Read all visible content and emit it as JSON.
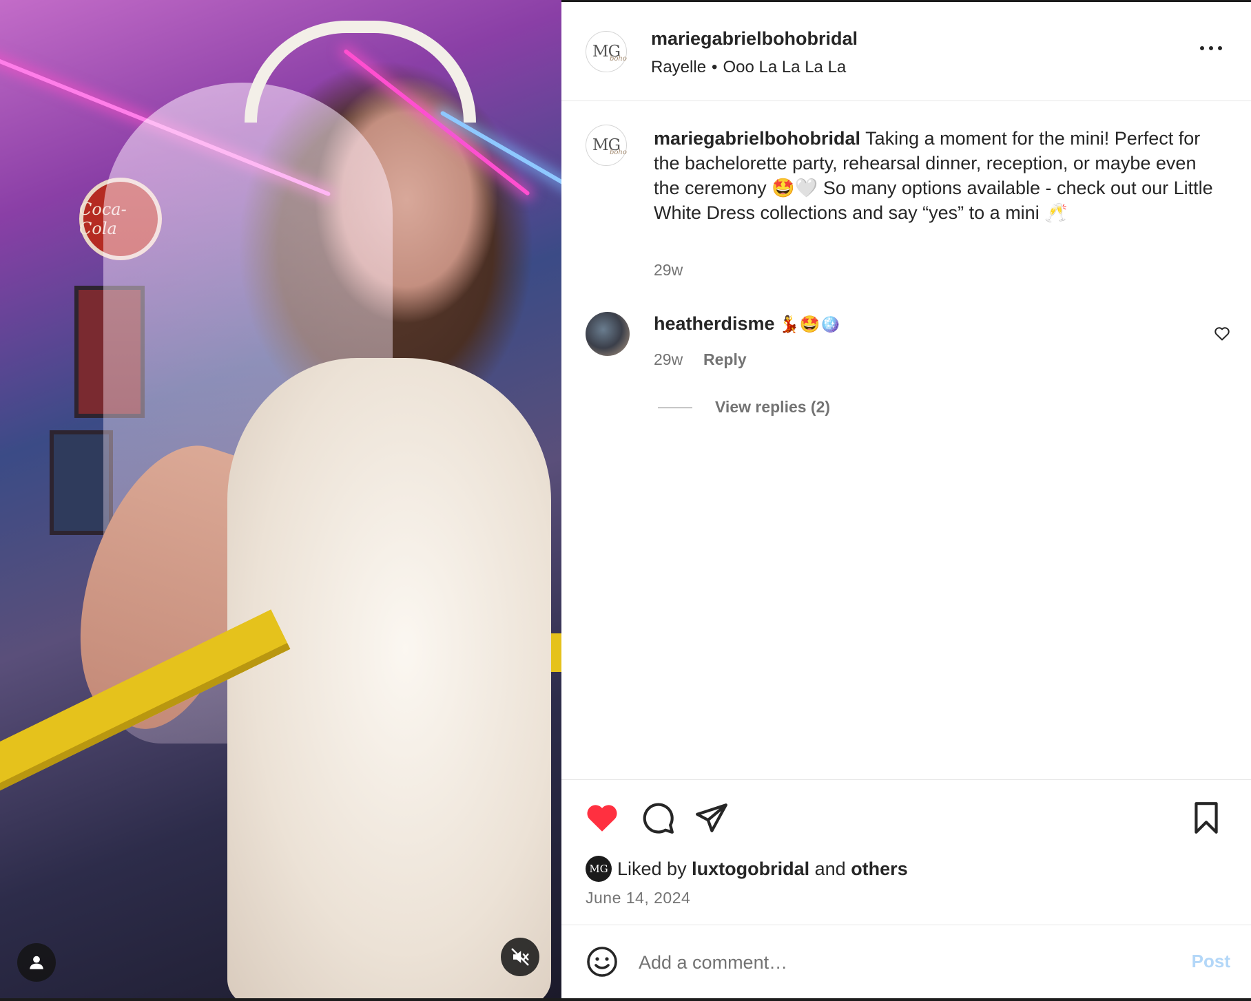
{
  "post": {
    "username": "mariegabrielbohobridal",
    "audio": {
      "artist": "Rayelle",
      "separator": "•",
      "track": "Ooo La La La La"
    },
    "avatar_text": {
      "mg": "MG",
      "boho": "boho"
    },
    "caption": {
      "username": "mariegabrielbohobridal",
      "text": "Taking a moment for the mini! Perfect for the bachelorette party, rehearsal dinner, reception, or maybe even the ceremony 🤩🤍 So many options available - check out our Little White Dress collections and say “yes” to a mini 🥂",
      "time": "29w"
    },
    "comments": [
      {
        "username": "heatherdisme",
        "text": "💃🤩🪩",
        "time": "29w",
        "reply_label": "Reply",
        "view_replies_label": "View replies (2)"
      }
    ],
    "likes": {
      "avatar_text": "MG",
      "prefix": "Liked by",
      "user": "luxtogobridal",
      "connector": "and",
      "others": "others"
    },
    "date": "June 14, 2024",
    "add_comment_placeholder": "Add a comment…",
    "post_button": "Post"
  },
  "media": {
    "sign_text": "Coca-Cola"
  },
  "icons": {
    "more": "more-options-icon",
    "like": "heart-filled-icon",
    "comment": "comment-bubble-icon",
    "share": "share-paper-plane-icon",
    "save": "bookmark-icon",
    "emoji": "emoji-smile-icon",
    "user_tag": "user-icon",
    "mute": "volume-muted-icon",
    "comment_like": "heart-outline-icon"
  },
  "colors": {
    "like_red": "#ff3040",
    "post_disabled": "#b3d7f8",
    "secondary_text": "#737373"
  }
}
